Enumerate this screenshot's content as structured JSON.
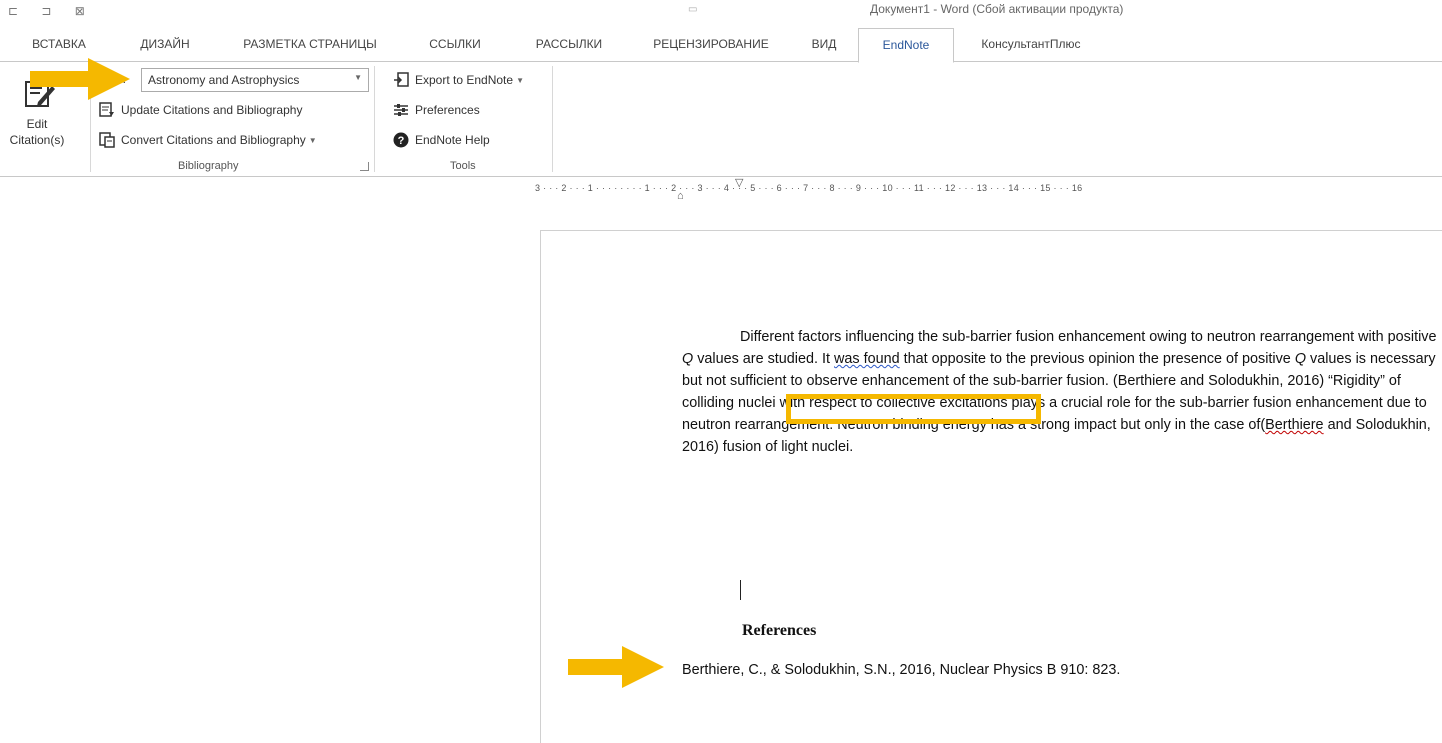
{
  "titlebar": {
    "qat_icons": "⊏ ⊐ ⊠",
    "doc_title": "Документ1 - Word (Сбой активации продукта)"
  },
  "tabs": [
    {
      "label": "ВСТАВКА"
    },
    {
      "label": "ДИЗАЙН"
    },
    {
      "label": "РАЗМЕТКА СТРАНИЦЫ"
    },
    {
      "label": "ССЫЛКИ"
    },
    {
      "label": "РАССЫЛКИ"
    },
    {
      "label": "РЕЦЕНЗИРОВАНИЕ"
    },
    {
      "label": "ВИД"
    },
    {
      "label": "EndNote",
      "active": true
    },
    {
      "label": "КонсультантПлюс"
    }
  ],
  "ribbon": {
    "edit_citations_label": "Edit Citation(s)",
    "style_label": "e:",
    "style_value": "Astronomy and Astrophysics",
    "update_label": "Update Citations and Bibliography",
    "convert_label": "Convert Citations and Bibliography",
    "bibliography_group": "Bibliography",
    "export_label": "Export to EndNote",
    "preferences_label": "Preferences",
    "help_label": "EndNote Help",
    "tools_group": "Tools"
  },
  "ruler": {
    "text": "3 · · · 2 · · · 1 · · · · · · · · 1 · · · 2 · · · 3 · · · 4 · · · 5 · · · 6 · · · 7 · · · 8 · · · 9 · · · 10 · · · 11 · · · 12 · · · 13 · · · 14 · · · 15 · · · 16"
  },
  "document": {
    "p1": "Different factors influencing the sub-barrier fusion enhancement owing to neutron rearrangement with positive ",
    "q1": "Q",
    "p2": " values are studied. It ",
    "was_found": "was found",
    "p3": " that opposite to the previous opinion the presence of positive ",
    "q2": "Q",
    "p4": " values is necessary but not sufficient to observe enhancement of the sub-barrier fusion. ",
    "cite1": "(Berthiere and Solodukhin, 2016)",
    "p5": " “Rigidity” of colliding nuclei with respect to collective excitations plays a crucial role for the sub-barrier fusion enhancement due to neutron rearrangement. Neutron binding energy has a strong impact but only in the case of",
    "cite2_open": "(",
    "cite2_name": "Berthiere",
    "cite2_rest": " and Solodukhin, 2016)",
    "p6": " fusion of light nuclei.",
    "references_heading": "References",
    "reference_entry": "Berthiere, C., & Solodukhin, S.N., 2016, Nuclear Physics B 910: 823."
  },
  "colors": {
    "annotation": "#f5b800",
    "active_tab": "#2b579a"
  }
}
